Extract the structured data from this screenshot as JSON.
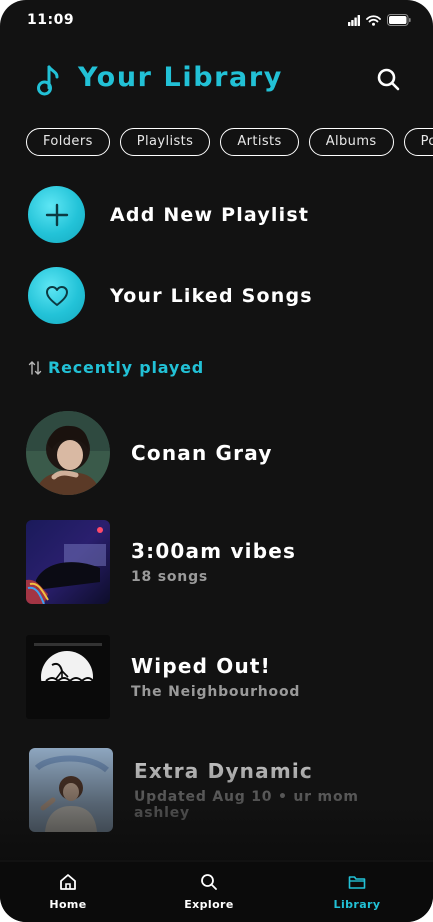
{
  "status_bar": {
    "time": "11:09",
    "icons": [
      "signal-icon",
      "wifi-icon",
      "battery-icon"
    ]
  },
  "header": {
    "title": "Your Library",
    "logo_icon": "music-note-icon",
    "search_icon": "search-icon"
  },
  "filters": [
    {
      "label": "Folders"
    },
    {
      "label": "Playlists"
    },
    {
      "label": "Artists"
    },
    {
      "label": "Albums"
    },
    {
      "label": "Podcasts"
    }
  ],
  "actions": {
    "add_playlist": {
      "label": "Add New Playlist",
      "icon": "plus-icon"
    },
    "liked_songs": {
      "label": "Your Liked Songs",
      "icon": "heart-icon"
    }
  },
  "section": {
    "label": "Recently played",
    "icon": "sort-icon"
  },
  "items": [
    {
      "title": "Conan Gray",
      "subtitle": "",
      "kind": "artist"
    },
    {
      "title": "3:00am vibes",
      "subtitle": "18 songs",
      "kind": "playlist"
    },
    {
      "title": "Wiped Out!",
      "subtitle": "The Neighbourhood",
      "kind": "album"
    },
    {
      "title": "Extra Dynamic",
      "subtitle": "Updated Aug 10 • ur mom ashley",
      "kind": "playlist"
    }
  ],
  "nav": {
    "home": {
      "label": "Home",
      "icon": "home-icon"
    },
    "explore": {
      "label": "Explore",
      "icon": "search-icon"
    },
    "library": {
      "label": "Library",
      "icon": "folder-icon",
      "active": true
    }
  },
  "colors": {
    "accent": "#22c1d6",
    "background": "#121212",
    "muted_text": "#9a9a9a"
  }
}
